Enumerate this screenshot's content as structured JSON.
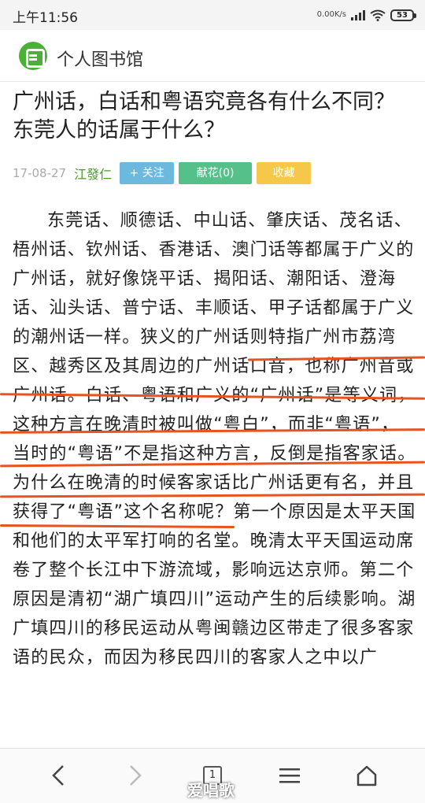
{
  "status_bar": {
    "time": "上午11:56",
    "net_speed": "0.00K/s",
    "battery": "53"
  },
  "header": {
    "site_name": "个人图书馆"
  },
  "article": {
    "title": "广州话，白话和粤语究竟各有什么不同？东莞人的话属于什么？",
    "date": "17-08-27",
    "author": "江發仁",
    "follow_label": "+ 关注",
    "flower_label": "献花(0)",
    "collect_label": "收藏",
    "body": "东莞话、顺德话、中山话、肇庆话、茂名话、梧州话、钦州话、香港话、澳门话等都属于广义的广州话，就好像饶平话、揭阳话、潮阳话、澄海话、汕头话、普宁话、丰顺话、甲子话都属于广义的潮州话一样。狭义的广州话则特指广州市荔湾区、越秀区及其周边的广州话口音，也称广州音或广州话。白话、粤语和广义的“广州话”是等义词，这种方言在晚清时被叫做“粤白”，而非“粤语”，当时的“粤语”不是指这种方言，反倒是指客家话。为什么在晚清的时候客家话比广州话更有名，并且获得了“粤语”这个名称呢？第一个原因是太平天国和他们的太平军打响的名堂。晚清太平天国运动席卷了整个长江中下游流域，影响远达京师。第二个原因是清初“湖广填四川”运动产生的后续影响。湖广填四川的移民运动从粤闽赣边区带走了很多客家语的民众，而因为移民四川的客家人之中以广"
  },
  "nav": {
    "tab_count": "1"
  },
  "watermark": "爱唱歌",
  "colors": {
    "brand_green": "#4caf3a",
    "author_green": "#4c9a2a",
    "follow_blue": "#6cb9dd",
    "flower_green": "#56c08a",
    "collect_yellow": "#f6c84a",
    "highlight_orange": "#e8531f"
  }
}
